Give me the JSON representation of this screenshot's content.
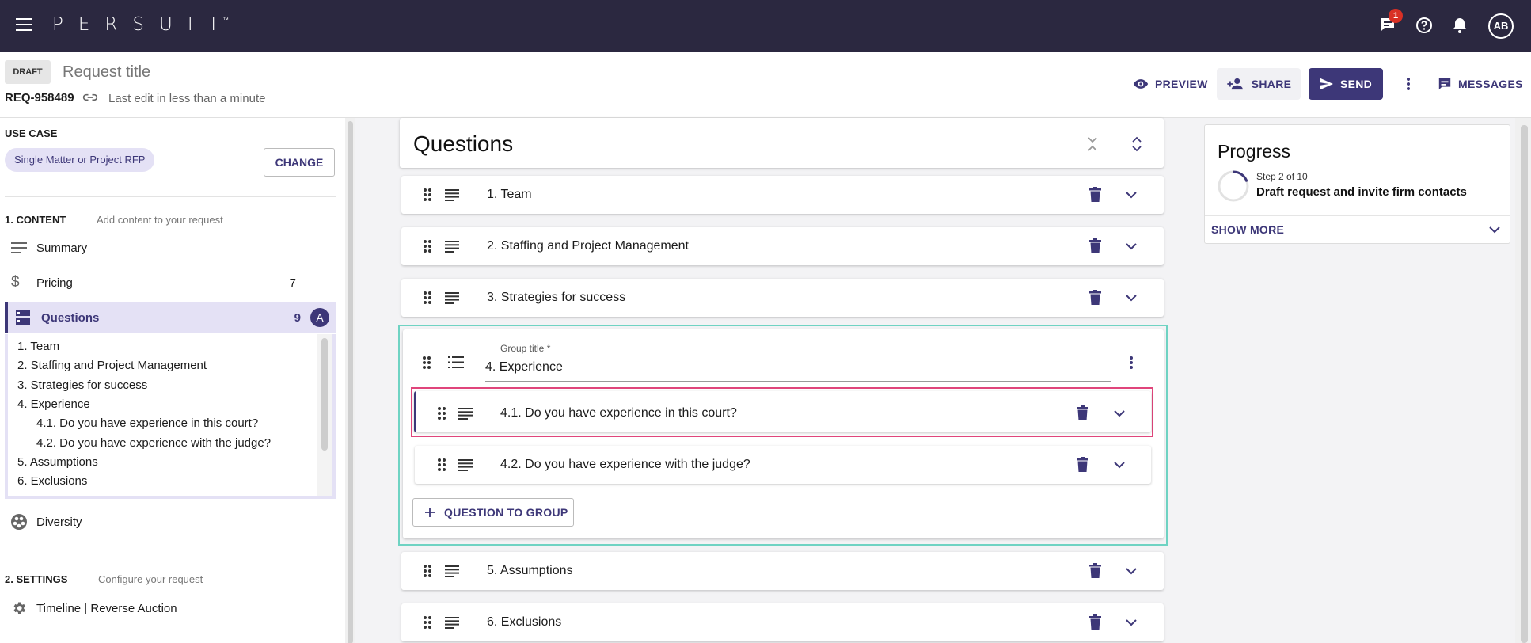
{
  "topbar": {
    "logo_text": "PERSUIT",
    "logo_tm": "™",
    "chat_badge": "1",
    "avatar_initials": "AB"
  },
  "header": {
    "status_chip": "DRAFT",
    "title_placeholder": "Request title",
    "request_id": "REQ-958489",
    "last_edit": "Last edit in less than a minute",
    "preview_label": "PREVIEW",
    "share_label": "SHARE",
    "send_label": "SEND",
    "messages_label": "MESSAGES"
  },
  "sidebar": {
    "use_case_heading": "USE CASE",
    "use_case_value": "Single Matter or Project RFP",
    "change_label": "CHANGE",
    "content_heading": "1. CONTENT",
    "content_sub": "Add content to your request",
    "items": [
      {
        "label": "Summary",
        "count": ""
      },
      {
        "label": "Pricing",
        "count": "7"
      },
      {
        "label": "Questions",
        "count": "9",
        "badge": "A"
      },
      {
        "label": "Diversity",
        "count": ""
      }
    ],
    "question_list": [
      "1. Team",
      "2. Staffing and Project Management",
      "3. Strategies for success",
      "4. Experience",
      "4.1. Do you have experience in this court?",
      "4.2. Do you have experience with the judge?",
      "5. Assumptions",
      "6. Exclusions"
    ],
    "settings_heading": "2. SETTINGS",
    "settings_sub": "Configure your request",
    "settings_items": [
      {
        "label": "Timeline | Reverse Auction"
      }
    ]
  },
  "main": {
    "title": "Questions",
    "questions": [
      "1. Team",
      "2. Staffing and Project Management",
      "3. Strategies for success",
      "5. Assumptions",
      "6. Exclusions"
    ],
    "group": {
      "field_label": "Group title *",
      "field_value": "4. Experience",
      "sub_questions": [
        "4.1. Do you have experience in this court?",
        "4.2. Do you have experience with the judge?"
      ],
      "add_button_label": "QUESTION TO GROUP"
    }
  },
  "progress": {
    "title": "Progress",
    "step_text": "Step 2 of 10",
    "step_fraction": 0.2,
    "step_name": "Draft request and invite firm contacts",
    "show_more_label": "SHOW MORE"
  },
  "colors": {
    "topbar_bg": "#2b2840",
    "accent": "#3d3778",
    "accent_light": "#e4e1f5",
    "group_outline": "#6fd3c3",
    "selected_outline": "#e0457b",
    "badge_red": "#d93025"
  }
}
